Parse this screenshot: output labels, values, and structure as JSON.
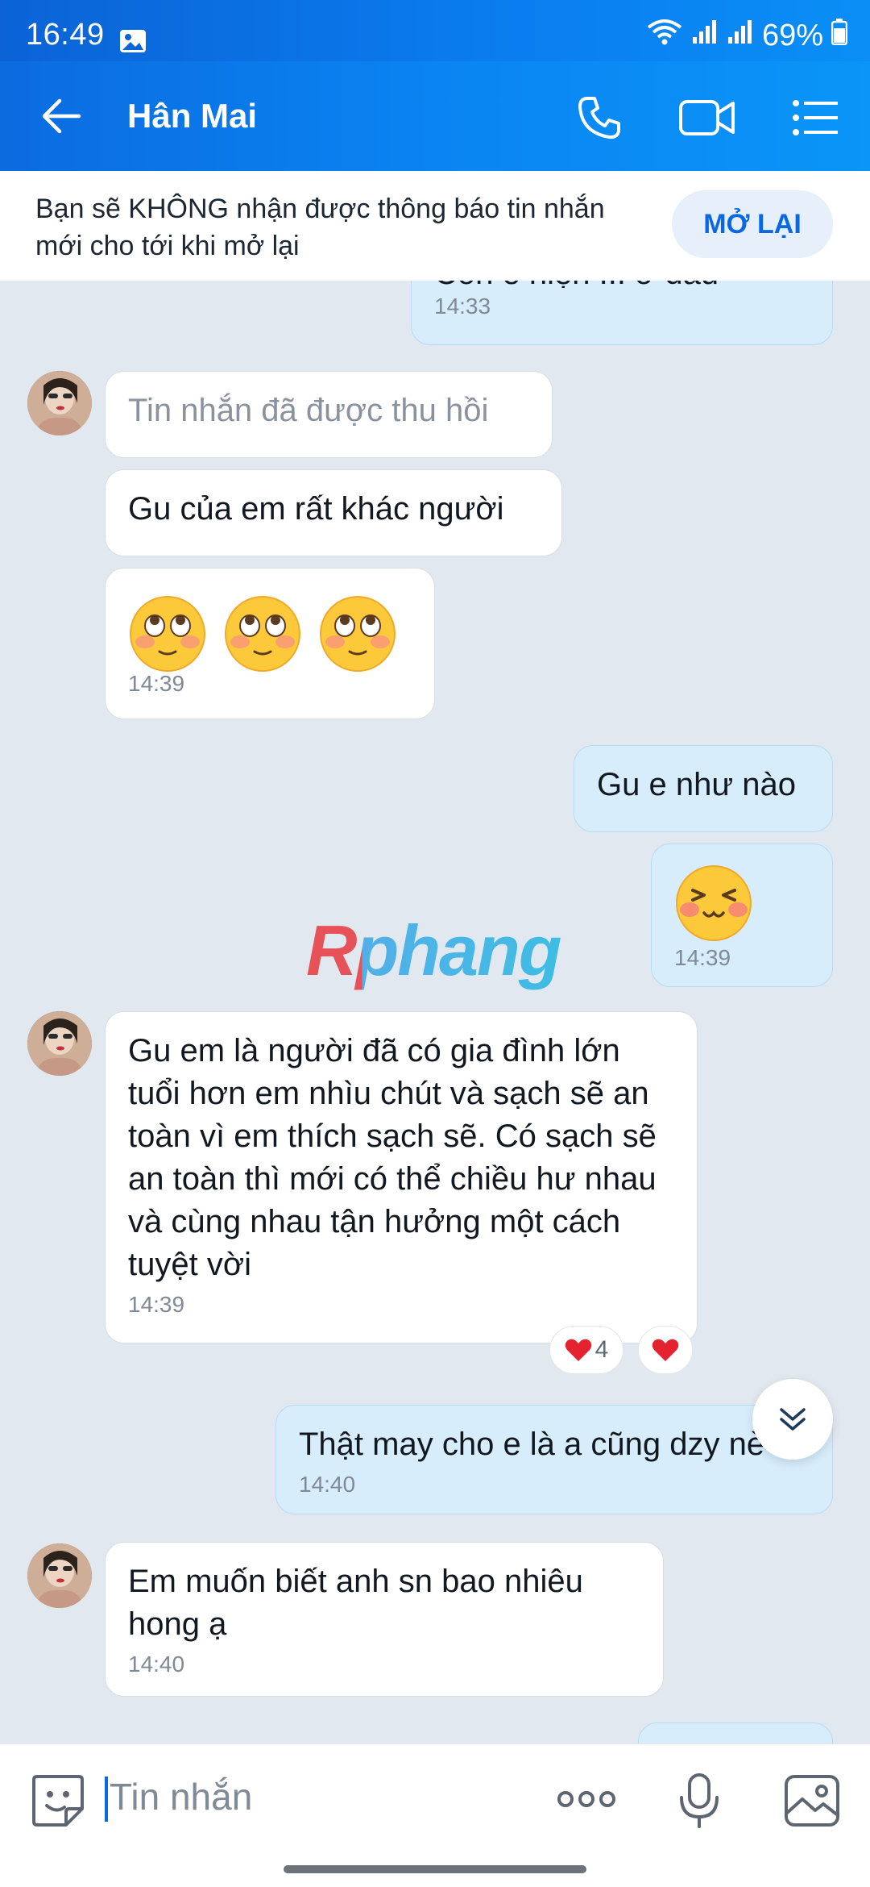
{
  "status_bar": {
    "time": "16:49",
    "battery": "69%",
    "icons": [
      "gallery-icon",
      "wifi-icon",
      "signal-icon",
      "signal-icon",
      "battery-icon"
    ]
  },
  "header": {
    "contact_name": "Hân Mai",
    "icons": [
      "back-arrow-icon",
      "phone-icon",
      "video-call-icon",
      "menu-list-icon"
    ]
  },
  "notice": {
    "text": "Bạn sẽ KHÔNG nhận được thông báo tin nhắn mới cho tới khi mở lại",
    "button": "MỞ LẠI"
  },
  "messages": [
    {
      "dir": "out",
      "text": "Còn e hiện ... ở đâu",
      "time": "14:33",
      "partial": true
    },
    {
      "dir": "in",
      "text": "Tin nhắn đã được thu hồi",
      "recalled": true
    },
    {
      "dir": "in",
      "text": "Gu của em rất khác người"
    },
    {
      "dir": "in",
      "emoji": "rolling-eyes-blush-emoji ×3",
      "time": "14:39"
    },
    {
      "dir": "out",
      "text": "Gu e như nào"
    },
    {
      "dir": "out",
      "emoji": "grinning-squint-emoji",
      "time": "14:39"
    },
    {
      "dir": "in",
      "text": "Gu em là người đã có gia đình lớn tuổi hơn em nhìu chút và sạch sẽ an toàn vì em thích sạch sẽ. Có sạch sẽ an toàn thì mới có thể chiều hư nhau và cùng nhau tận hưởng một cách tuyệt vời",
      "time": "14:39",
      "reaction_count": "4"
    },
    {
      "dir": "out",
      "text": "Thật may cho e là a cũng dzy nè",
      "time": "14:40"
    },
    {
      "dir": "in",
      "text": "Em muốn biết anh sn bao nhiêu hong ạ",
      "time": "14:40"
    }
  ],
  "watermark": "Rphang",
  "input_bar": {
    "placeholder": "Tin nhắn",
    "icons": [
      "sticker-icon",
      "more-dots-icon",
      "microphone-icon",
      "image-icon"
    ]
  },
  "colors": {
    "header_gradient_start": "#0b6be0",
    "header_gradient_end": "#0a95f8",
    "accent": "#0a68e0",
    "chat_bg": "#e2e8ef",
    "bubble_out": "#d7edfc",
    "bubble_in": "#ffffff"
  }
}
